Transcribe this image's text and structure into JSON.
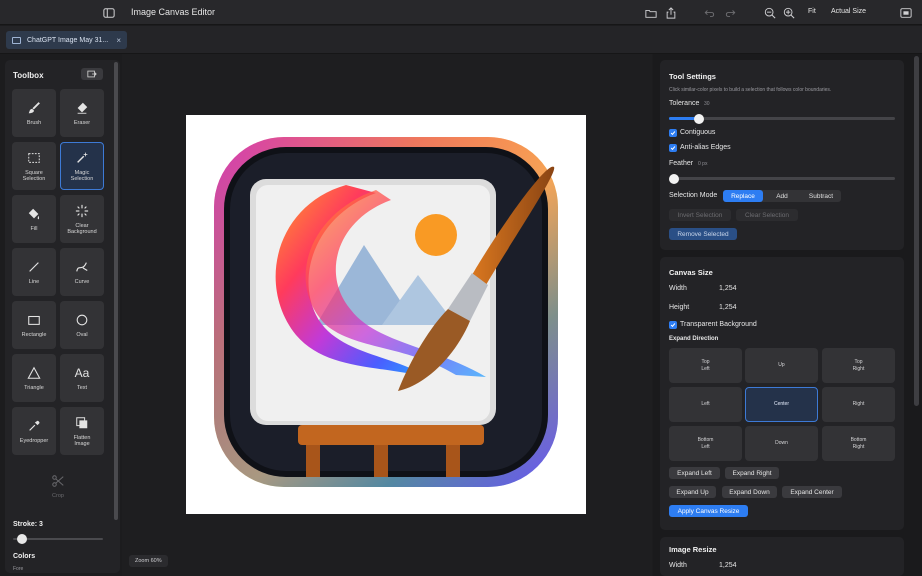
{
  "titlebar": {
    "title": "Image Canvas Editor",
    "sidebar_icon": "sidebar-toggle-icon",
    "fit_label": "Fit",
    "actual_size_label": "Actual Size",
    "icons": [
      "folder-icon",
      "share-icon",
      "undo-icon",
      "redo-icon",
      "zoom-out-icon",
      "zoom-in-icon",
      "fullscreen-icon"
    ]
  },
  "tab": {
    "label": "ChatGPT Image May 31...",
    "close": "×"
  },
  "toolbox": {
    "title": "Toolbox",
    "tools": [
      {
        "label": "Brush",
        "icon": "brush-icon",
        "active": false
      },
      {
        "label": "Eraser",
        "icon": "eraser-icon",
        "active": false
      },
      {
        "label": "Square\nSelection",
        "icon": "square-selection-icon",
        "active": false
      },
      {
        "label": "Magic\nSelection",
        "icon": "magic-wand-icon",
        "active": true
      },
      {
        "label": "Fill",
        "icon": "fill-bucket-icon",
        "active": false
      },
      {
        "label": "Clear\nBackground",
        "icon": "sparkle-icon",
        "active": false
      },
      {
        "label": "Line",
        "icon": "line-icon",
        "active": false
      },
      {
        "label": "Curve",
        "icon": "curve-icon",
        "active": false
      },
      {
        "label": "Rectangle",
        "icon": "rectangle-icon",
        "active": false
      },
      {
        "label": "Oval",
        "icon": "oval-icon",
        "active": false
      },
      {
        "label": "Triangle",
        "icon": "triangle-icon",
        "active": false
      },
      {
        "label": "Text",
        "icon": "text-icon",
        "active": false
      },
      {
        "label": "Eyedropper",
        "icon": "eyedropper-icon",
        "active": false
      },
      {
        "label": "Flatten\nImage",
        "icon": "flatten-icon",
        "active": false
      },
      {
        "label": "Crop",
        "icon": "scissors-icon",
        "active": false
      }
    ],
    "stroke_label": "Stroke: 3",
    "stroke_value": 3,
    "colors_label": "Colors",
    "fore_label": "Fore"
  },
  "canvas": {
    "zoom_label": "Zoom 60%"
  },
  "tool_settings": {
    "title": "Tool Settings",
    "hint": "Click similar-color pixels to build a selection that follows color boundaries.",
    "tolerance_label": "Tolerance",
    "tolerance_value": "30",
    "tolerance_fraction": 0.12,
    "contiguous_label": "Contiguous",
    "antialias_label": "Anti-alias Edges",
    "feather_label": "Feather",
    "feather_value": "0 px",
    "feather_fraction": 0.0,
    "mode_label": "Selection Mode",
    "modes": [
      "Replace",
      "Add",
      "Subtract"
    ],
    "invert_label": "Invert Selection",
    "clear_label": "Clear Selection",
    "remove_label": "Remove Selected"
  },
  "canvas_size": {
    "title": "Canvas Size",
    "width_label": "Width",
    "width_value": "1,254",
    "height_label": "Height",
    "height_value": "1,254",
    "transparent_label": "Transparent Background",
    "expand_direction_label": "Expand Direction",
    "directions": [
      "Top\nLeft",
      "Up",
      "Top\nRight",
      "Left",
      "Center",
      "Right",
      "Bottom\nLeft",
      "Down",
      "Bottom\nRight"
    ],
    "expand_left": "Expand Left",
    "expand_right": "Expand Right",
    "expand_up": "Expand Up",
    "expand_down": "Expand Down",
    "expand_center": "Expand Center",
    "apply_label": "Apply Canvas Resize"
  },
  "image_resize": {
    "title": "Image Resize",
    "width_label": "Width",
    "width_value": "1,254"
  },
  "colors": {
    "accent": "#2d7df2",
    "panel": "#232326",
    "canvas_bg": "#1e1e20"
  }
}
